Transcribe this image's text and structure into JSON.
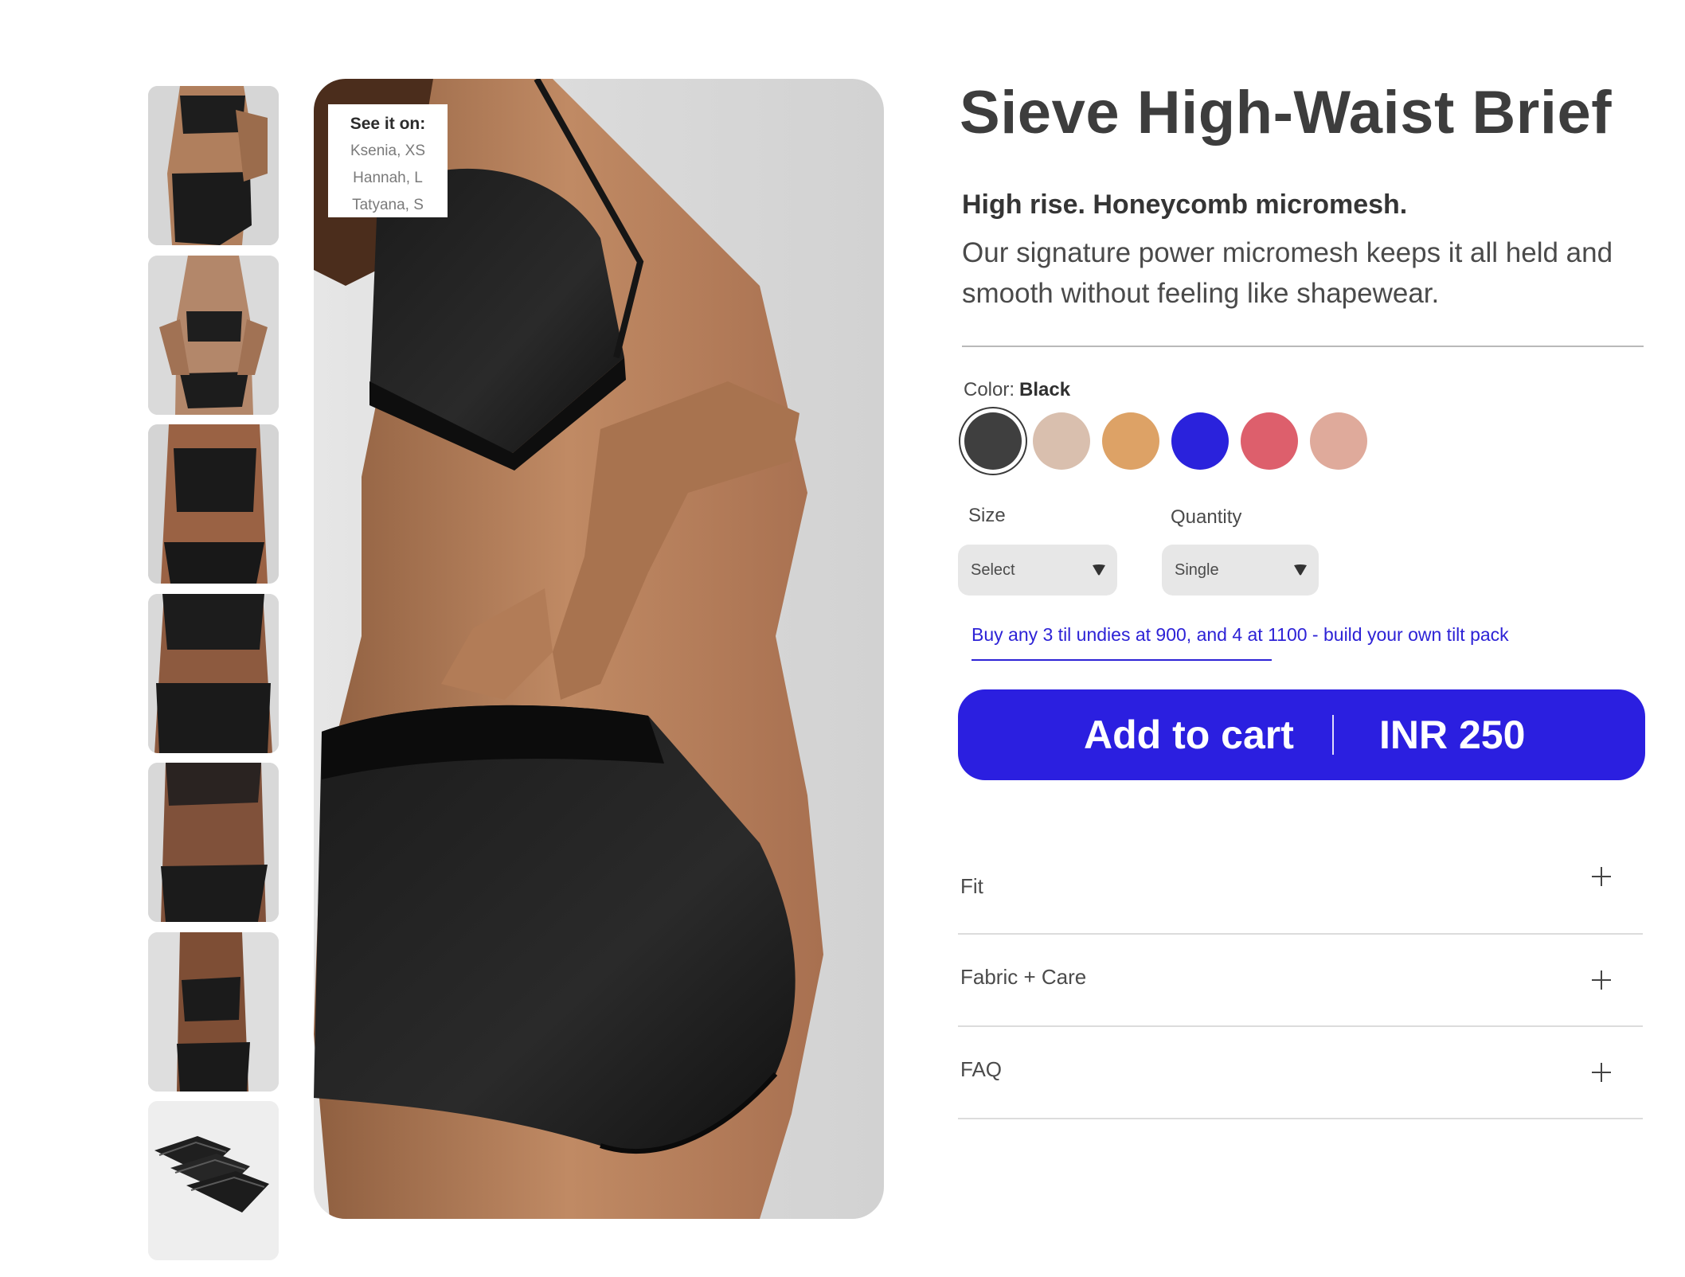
{
  "thumbnails": [
    {
      "label": "crop-top-back-view"
    },
    {
      "label": "front-view"
    },
    {
      "label": "plus-front-view"
    },
    {
      "label": "plus-back-view"
    },
    {
      "label": "sheer-front-view"
    },
    {
      "label": "side-view"
    },
    {
      "label": "three-pack-flat-lay"
    }
  ],
  "main_image": {
    "see_it_on": {
      "heading": "See it on:",
      "models": [
        "Ksenia, XS",
        "Hannah, L",
        "Tatyana, S"
      ]
    }
  },
  "product": {
    "title": "Sieve High-Waist Brief",
    "tagline": "High rise. Honeycomb micromesh.",
    "description": "Our signature power micromesh keeps it all held and smooth without feeling like shapewear."
  },
  "color": {
    "label": "Color:",
    "selected": "Black",
    "swatches": [
      {
        "name": "black",
        "hex": "#3f3f3f"
      },
      {
        "name": "beige",
        "hex": "#d9bfae"
      },
      {
        "name": "caramel",
        "hex": "#dda266"
      },
      {
        "name": "cobalt",
        "hex": "#2a22dc"
      },
      {
        "name": "coral",
        "hex": "#dd5f6c"
      },
      {
        "name": "blush",
        "hex": "#dfaa9b"
      }
    ]
  },
  "size": {
    "label": "Size",
    "value": "Select"
  },
  "quantity": {
    "label": "Quantity",
    "value": "Single"
  },
  "promo": "Buy any 3 til undies at 900, and 4 at 1100 - build your own tilt pack",
  "cart": {
    "label": "Add to cart",
    "price": "INR 250",
    "color": "#2b1fe0"
  },
  "accordion": [
    {
      "title": "Fit"
    },
    {
      "title": "Fabric + Care"
    },
    {
      "title": "FAQ"
    }
  ]
}
